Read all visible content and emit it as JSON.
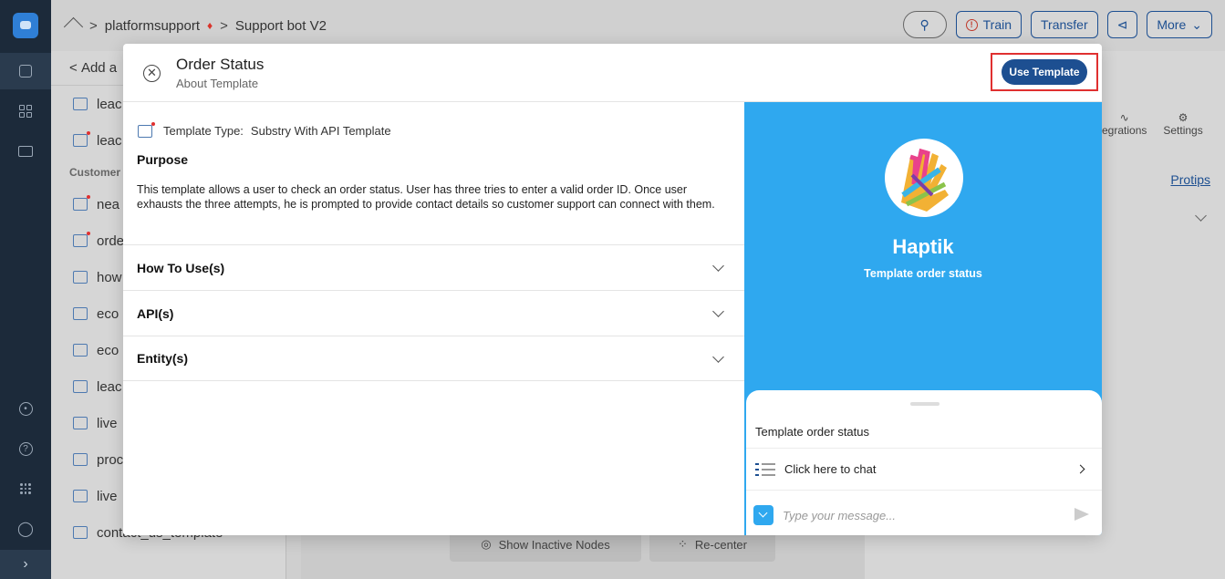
{
  "topbar": {
    "crumb1": "platformsupport",
    "crumb2": "Support bot V2",
    "train": "Train",
    "transfer": "Transfer",
    "more": "More"
  },
  "bglist": {
    "add_label": "Add a",
    "section": "Customer",
    "rows": [
      "leac",
      "leac",
      "nea",
      "orde",
      "how",
      "eco",
      "eco",
      "leac",
      "live",
      "proc",
      "live",
      "contact_us_template"
    ]
  },
  "canvas": {
    "inactive": "Show Inactive Nodes",
    "recenter": "Re-center"
  },
  "rightpanel": {
    "integrations": "egrations",
    "settings": "Settings",
    "protips": "Protips"
  },
  "modal": {
    "title": "Order Status",
    "subtitle": "About Template",
    "use_template": "Use Template",
    "template_type_label": "Template Type:",
    "template_type_value": "Substry With API Template",
    "purpose_title": "Purpose",
    "purpose_desc": "This template allows a user to check an order status. User has three tries to enter a valid order ID. Once user exhausts the three attempts, he is prompted to provide contact details so customer support can connect with them.",
    "sections": [
      "How To Use(s)",
      "API(s)",
      "Entity(s)"
    ]
  },
  "preview": {
    "brand": "Haptik",
    "brand_sub": "Template order status",
    "chat_title": "Template order status",
    "chat_option": "Click here to chat",
    "input_placeholder": "Type your message...",
    "accent": "#2fa8ef"
  }
}
